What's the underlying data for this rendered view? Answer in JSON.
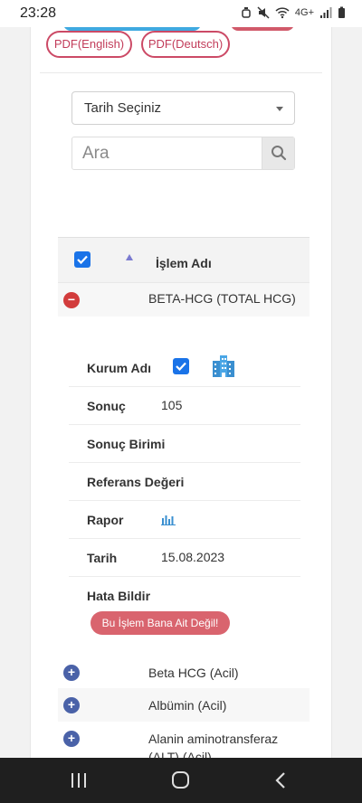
{
  "status_bar": {
    "time": "23:28",
    "signal_text": "4G+"
  },
  "pdf_buttons": {
    "english": "PDF(English)",
    "deutsch": "PDF(Deutsch)"
  },
  "date_select": {
    "value": "Tarih Seçiniz"
  },
  "search": {
    "placeholder": "Ara"
  },
  "table": {
    "header": {
      "column": "İşlem Adı"
    },
    "expanded_row": {
      "name": "BETA-HCG (TOTAL HCG)",
      "details": [
        {
          "label": "Kurum Adı",
          "value": ""
        },
        {
          "label": "Sonuç",
          "value": "105"
        },
        {
          "label": "Sonuç Birimi",
          "value": ""
        },
        {
          "label": "Referans Değeri",
          "value": ""
        },
        {
          "label": "Rapor",
          "value": ""
        },
        {
          "label": "Tarih",
          "value": "15.08.2023"
        },
        {
          "label": "Hata Bildir",
          "value": ""
        }
      ],
      "error_button": "Bu İşlem Bana Ait Değil!"
    },
    "rows": [
      {
        "name": "Beta HCG (Acil)"
      },
      {
        "name": "Albümin (Acil)"
      },
      {
        "name": "Alanin aminotransferaz (ALT) (Acil)"
      }
    ]
  },
  "colors": {
    "accent_red": "#cc4a66",
    "checkbox_blue": "#1a73e8",
    "expand_plus": "#4a62a8",
    "collapse_minus": "#d23c3c",
    "error_button": "#d9646e"
  },
  "icons": {
    "building": "building-icon",
    "report": "bar-chart-icon",
    "search": "search-icon"
  }
}
